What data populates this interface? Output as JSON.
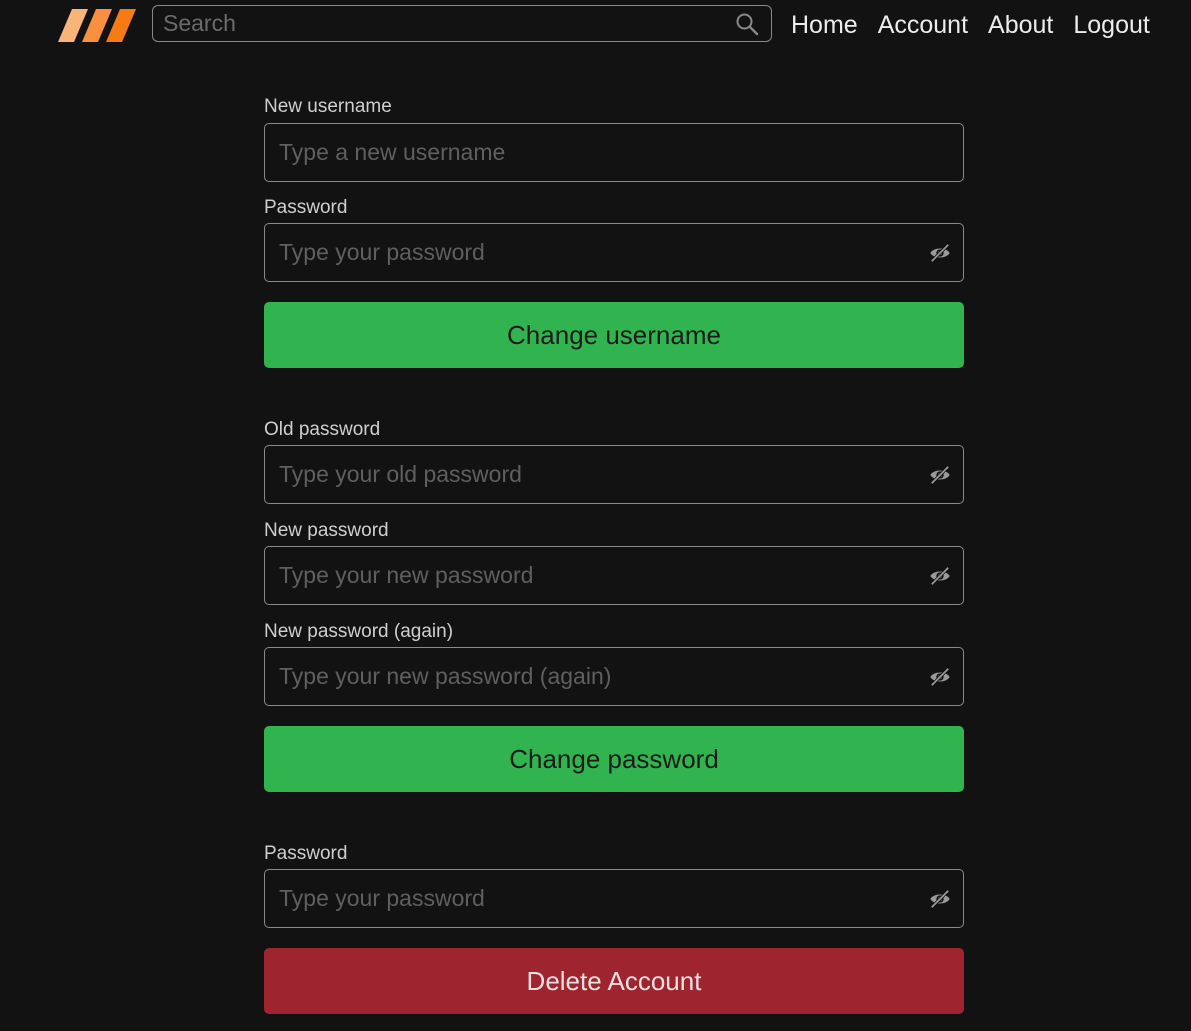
{
  "header": {
    "logo_icon": "triple-slash-logo-icon",
    "search": {
      "placeholder": "Search",
      "icon": "search-icon"
    },
    "nav": [
      {
        "label": "Home"
      },
      {
        "label": "Account"
      },
      {
        "label": "About"
      },
      {
        "label": "Logout"
      }
    ]
  },
  "change_username": {
    "new_username": {
      "label": "New username",
      "placeholder": "Type a new username"
    },
    "password": {
      "label": "Password",
      "placeholder": "Type your password",
      "icon": "eye-off-icon"
    },
    "button_label": "Change username"
  },
  "change_password": {
    "old_password": {
      "label": "Old password",
      "placeholder": "Type your old password",
      "icon": "eye-off-icon"
    },
    "new_password": {
      "label": "New password",
      "placeholder": "Type your new password",
      "icon": "eye-off-icon"
    },
    "new_password_again": {
      "label": "New password (again)",
      "placeholder": "Type your new password (again)",
      "icon": "eye-off-icon"
    },
    "button_label": "Change password"
  },
  "delete_account": {
    "password": {
      "label": "Password",
      "placeholder": "Type your password",
      "icon": "eye-off-icon"
    },
    "button_label": "Delete Account"
  },
  "colors": {
    "background": "#121212",
    "accent_green": "#31b44f",
    "danger_red": "#9e2430",
    "logo_orange": "#f57c14",
    "logo_orange_light": "#f9a35a"
  }
}
